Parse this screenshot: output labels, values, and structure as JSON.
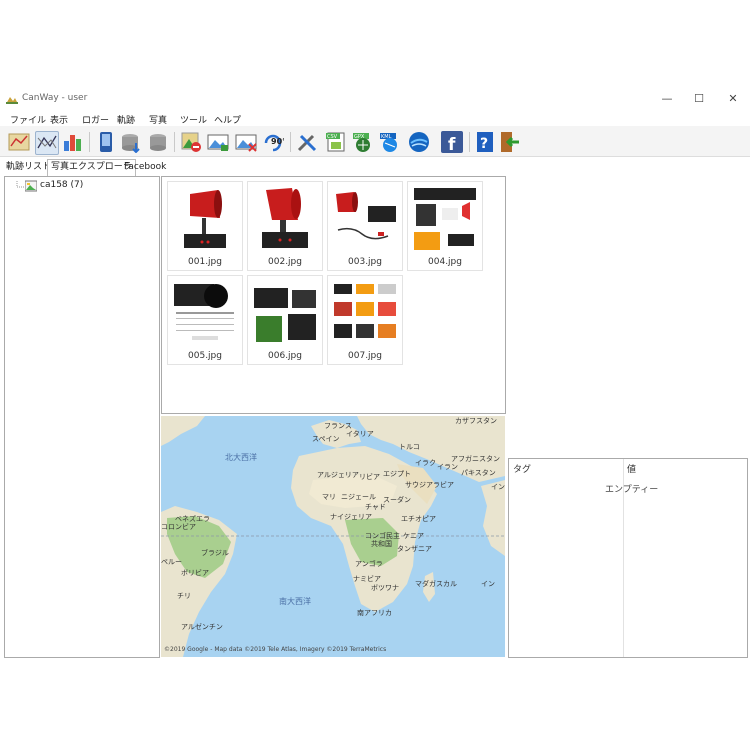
{
  "window": {
    "title": "CanWay - user"
  },
  "menu": [
    "ファイル",
    "表示",
    "ロガー",
    "軌跡",
    "写真",
    "ツール",
    "ヘルプ"
  ],
  "toolbar_icons": [
    "map-route-icon",
    "track-icon",
    "bar-chart-icon",
    "device-icon",
    "database-icon",
    "database-delete-icon",
    "photo-add-icon",
    "photo-import-icon",
    "photo-remove-icon",
    "rotate-icon",
    "tools-icon",
    "export-csv-icon",
    "export-gpx-icon",
    "export-kml-icon",
    "google-earth-icon",
    "facebook-icon",
    "help-icon",
    "exit-icon"
  ],
  "tabs": [
    "軌跡リスト",
    "写真エクスプローラ",
    "Facebook"
  ],
  "tree": {
    "root": "ca158 (7)"
  },
  "photos": [
    "001.jpg",
    "002.jpg",
    "003.jpg",
    "004.jpg",
    "005.jpg",
    "006.jpg",
    "007.jpg"
  ],
  "map": {
    "labels": [
      "フランス",
      "イタリア",
      "スペイン",
      "カザフスタン",
      "トルコ",
      "アフガニスタン",
      "イラク",
      "イラン",
      "パキスタン",
      "アルジェリア",
      "リビア",
      "エジプト",
      "サウジアラビア",
      "イン",
      "マリ",
      "ニジェール",
      "スーダン",
      "チャド",
      "ナイジェリア",
      "エチオピア",
      "ベネズエラ",
      "コロンビア",
      "コンゴ民主",
      "共和国",
      "ケニア",
      "タンザニア",
      "ブラジル",
      "ペルー",
      "ボリビア",
      "アンゴラ",
      "ナミビア",
      "ボツワナ",
      "マダガスカル",
      "チリ",
      "南アフリカ",
      "アルゼンチン",
      "イン"
    ],
    "oceans": [
      "北大西洋",
      "南大西洋"
    ],
    "attribution": "©2019 Google - Map data ©2019 Tele Atlas, Imagery ©2019 TerraMetrics"
  },
  "properties": {
    "col_tag": "タグ",
    "col_value": "値",
    "empty": "エンプティー"
  },
  "colors": {
    "toolbar_bg": "#f4f4f4",
    "ocean": "#a8d3f1",
    "land": "#e9e4cf",
    "green": "#a9cf8f"
  }
}
